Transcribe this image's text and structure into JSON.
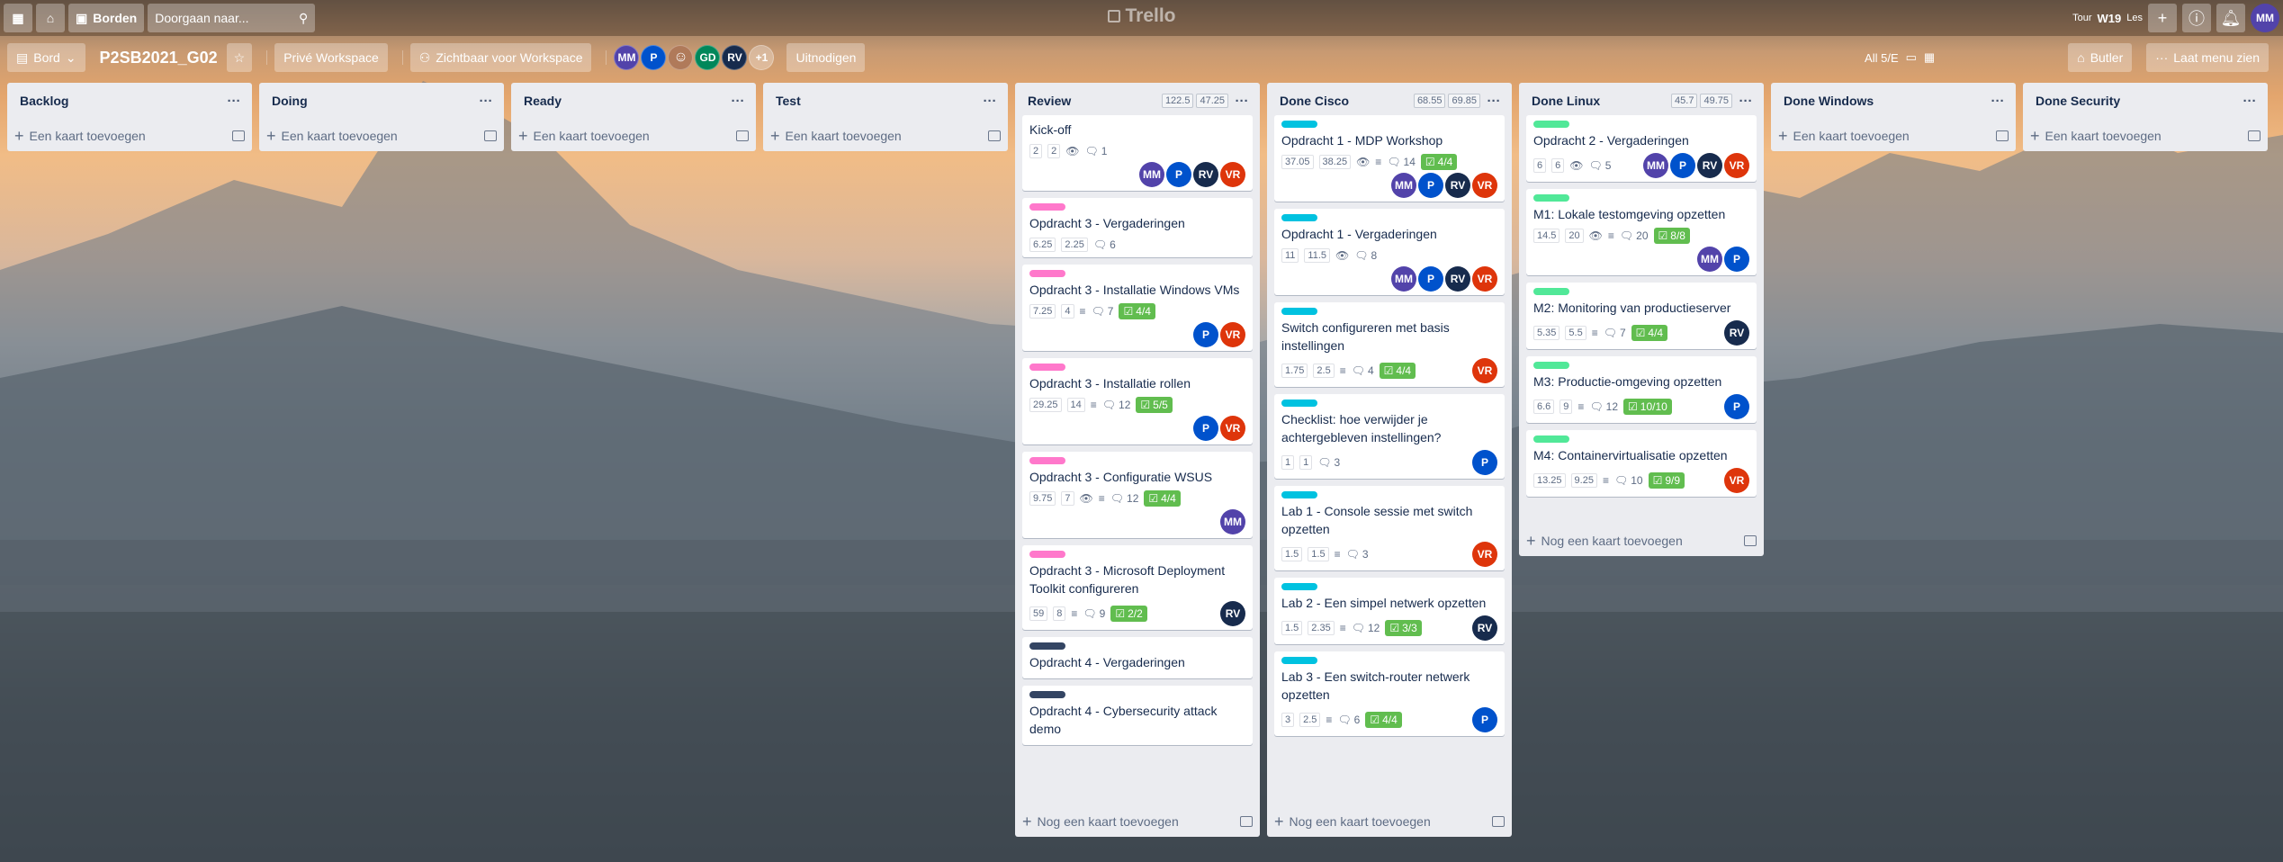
{
  "colors": {
    "avatar_MM": "#5243aa",
    "avatar_P": "#0052cc",
    "avatar_RV": "#172b4d",
    "avatar_VR": "#de350b",
    "avatar_GD": "#00875a",
    "label_pink": "#ff78cb",
    "label_navy": "#344563",
    "label_sky": "#00c2e0",
    "label_lime": "#51e898",
    "checklist_green": "#61bd4f"
  },
  "topbar": {
    "apps_icon": "grid-icon",
    "home_icon": "home-icon",
    "boards_label": "Borden",
    "search_placeholder": "Doorgaan naar...",
    "search_icon": "search-icon",
    "logo_text": "Trello",
    "tour_text": "Tour",
    "week_text": "W19",
    "les_text": "Les",
    "user_initials": "MM"
  },
  "board": {
    "view_label": "Bord",
    "title": "P2SB2021_G02",
    "workspace_label": "Privé Workspace",
    "visibility_label": "Zichtbaar voor Workspace",
    "members": [
      "MM",
      "P",
      "",
      "GD",
      "RV"
    ],
    "members_more": "+1",
    "invite_label": "Uitnodigen",
    "all_label": "All 5/E",
    "butler_label": "Butler",
    "menu_label": "Laat menu zien"
  },
  "lists": [
    {
      "name": "Backlog",
      "add_label": "Een kaart toevoegen",
      "cards": []
    },
    {
      "name": "Doing",
      "add_label": "Een kaart toevoegen",
      "cards": []
    },
    {
      "name": "Ready",
      "add_label": "Een kaart toevoegen",
      "cards": []
    },
    {
      "name": "Test",
      "add_label": "Een kaart toevoegen",
      "cards": []
    },
    {
      "name": "Review",
      "badges": [
        "122.5",
        "47.25"
      ],
      "add_label": "Nog een kaart toevoegen",
      "cards": [
        {
          "title": "Kick-off",
          "pts": [
            "2",
            "2"
          ],
          "watch": true,
          "desc": false,
          "comments": "1",
          "checklist": "",
          "members": [
            "MM",
            "P",
            "RV",
            "VR"
          ]
        },
        {
          "label": "label_pink",
          "title": "Opdracht 3 - Vergaderingen",
          "pts": [
            "6.25",
            "2.25"
          ],
          "watch": false,
          "desc": false,
          "comments": "6",
          "checklist": "",
          "members": []
        },
        {
          "label": "label_pink",
          "title": "Opdracht 3 - Installatie Windows VMs",
          "pts": [
            "7.25",
            "4"
          ],
          "watch": false,
          "desc": true,
          "comments": "7",
          "checklist": "4/4",
          "members": [
            "P",
            "VR"
          ]
        },
        {
          "label": "label_pink",
          "title": "Opdracht 3 - Installatie rollen",
          "pts": [
            "29.25",
            "14"
          ],
          "watch": false,
          "desc": true,
          "comments": "12",
          "checklist": "5/5",
          "members": [
            "P",
            "VR"
          ]
        },
        {
          "label": "label_pink",
          "title": "Opdracht 3 - Configuratie WSUS",
          "pts": [
            "9.75",
            "7"
          ],
          "watch": true,
          "desc": true,
          "comments": "12",
          "checklist": "4/4",
          "members": [
            "MM"
          ]
        },
        {
          "label": "label_pink",
          "title": "Opdracht 3 - Microsoft Deployment Toolkit configureren",
          "pts": [
            "59",
            "8"
          ],
          "watch": false,
          "desc": true,
          "comments": "9",
          "checklist": "2/2",
          "members": [
            "RV"
          ],
          "inline_members": true
        },
        {
          "label": "label_navy",
          "title": "Opdracht 4 - Vergaderingen",
          "pts": [],
          "watch": false,
          "desc": false,
          "comments": "",
          "checklist": "",
          "members": []
        },
        {
          "label": "label_navy",
          "title": "Opdracht 4 - Cybersecurity attack demo",
          "pts": [],
          "watch": false,
          "desc": false,
          "comments": "",
          "checklist": "",
          "members": []
        }
      ]
    },
    {
      "name": "Done Cisco",
      "badges": [
        "68.55",
        "69.85"
      ],
      "add_label": "Nog een kaart toevoegen",
      "cards": [
        {
          "label": "label_sky",
          "title": "Opdracht 1 - MDP Workshop",
          "pts": [
            "37.05",
            "38.25"
          ],
          "watch": true,
          "desc": true,
          "comments": "14",
          "checklist": "4/4",
          "members": [
            "MM",
            "P",
            "RV",
            "VR"
          ]
        },
        {
          "label": "label_sky",
          "title": "Opdracht 1 - Vergaderingen",
          "pts": [
            "11",
            "11.5"
          ],
          "watch": true,
          "desc": false,
          "comments": "8",
          "checklist": "",
          "members": [
            "MM",
            "P",
            "RV",
            "VR"
          ]
        },
        {
          "label": "label_sky",
          "title": "Switch configureren met basis instellingen",
          "pts": [
            "1.75",
            "2.5"
          ],
          "watch": false,
          "desc": true,
          "comments": "4",
          "checklist": "4/4",
          "members": [
            "VR"
          ],
          "inline_members": true
        },
        {
          "label": "label_sky",
          "title": "Checklist: hoe verwijder je achtergebleven instellingen?",
          "pts": [
            "1",
            "1"
          ],
          "watch": false,
          "desc": false,
          "comments": "3",
          "checklist": "",
          "members": [
            "P"
          ],
          "inline_members": true
        },
        {
          "label": "label_sky",
          "title": "Lab 1 - Console sessie met switch opzetten",
          "pts": [
            "1.5",
            "1.5"
          ],
          "watch": false,
          "desc": true,
          "comments": "3",
          "checklist": "",
          "members": [
            "VR"
          ],
          "inline_members": true
        },
        {
          "label": "label_sky",
          "title": "Lab 2 - Een simpel netwerk opzetten",
          "pts": [
            "1.5",
            "2.35"
          ],
          "watch": false,
          "desc": true,
          "comments": "12",
          "checklist": "3/3",
          "members": [
            "RV"
          ],
          "inline_members": true
        },
        {
          "label": "label_sky",
          "title": "Lab 3 - Een switch-router netwerk opzetten",
          "pts": [
            "3",
            "2.5"
          ],
          "watch": false,
          "desc": true,
          "comments": "6",
          "checklist": "4/4",
          "members": [
            "P"
          ],
          "inline_members": true
        }
      ]
    },
    {
      "name": "Done Linux",
      "badges": [
        "45.7",
        "49.75"
      ],
      "add_label": "Nog een kaart toevoegen",
      "cards": [
        {
          "label": "label_lime",
          "title": "Opdracht 2 - Vergaderingen",
          "pts": [
            "6",
            "6"
          ],
          "watch": true,
          "desc": false,
          "comments": "5",
          "checklist": "",
          "members": [
            "MM",
            "P",
            "RV",
            "VR"
          ],
          "inline_members": true
        },
        {
          "label": "label_lime",
          "title": "M1: Lokale testomgeving opzetten",
          "pts": [
            "14.5",
            "20"
          ],
          "watch": true,
          "desc": true,
          "comments": "20",
          "checklist": "8/8",
          "members": [
            "MM",
            "P"
          ]
        },
        {
          "label": "label_lime",
          "title": "M2: Monitoring van productieserver",
          "pts": [
            "5.35",
            "5.5"
          ],
          "watch": false,
          "desc": true,
          "comments": "7",
          "checklist": "4/4",
          "members": [
            "RV"
          ],
          "inline_members": true
        },
        {
          "label": "label_lime",
          "title": "M3: Productie-omgeving opzetten",
          "pts": [
            "6.6",
            "9"
          ],
          "watch": false,
          "desc": true,
          "comments": "12",
          "checklist": "10/10",
          "members": [
            "P"
          ],
          "inline_members": true
        },
        {
          "label": "label_lime",
          "title": "M4: Containervirtualisatie opzetten",
          "pts": [
            "13.25",
            "9.25"
          ],
          "watch": false,
          "desc": true,
          "comments": "10",
          "checklist": "9/9",
          "members": [
            "VR"
          ],
          "inline_members": true
        }
      ]
    },
    {
      "name": "Done Windows",
      "add_label": "Een kaart toevoegen",
      "cards": []
    },
    {
      "name": "Done Security",
      "add_label": "Een kaart toevoegen",
      "cards": []
    }
  ]
}
